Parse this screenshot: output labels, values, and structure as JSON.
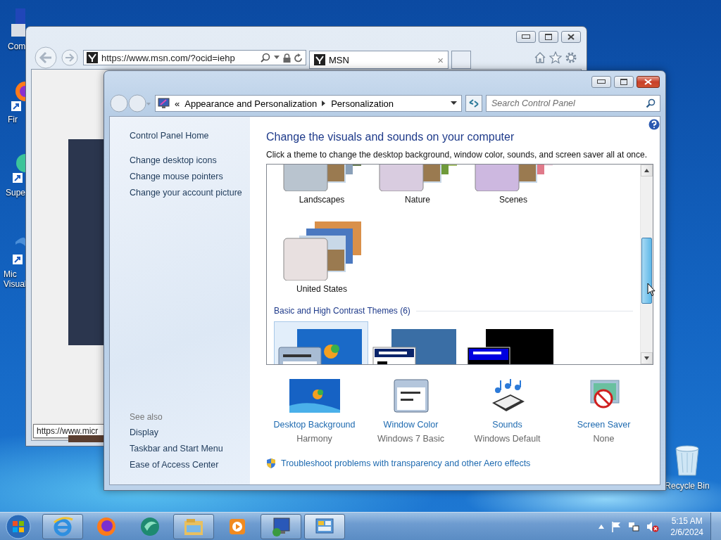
{
  "desktop": {
    "icons": [
      {
        "kind": "computer",
        "lines": [
          "Com"
        ]
      },
      {
        "kind": "firefox",
        "lines": [
          "Fir"
        ]
      },
      {
        "kind": "globe",
        "lines": [
          "Supe"
        ]
      },
      {
        "kind": "visual",
        "lines": [
          "Mic",
          "Visual"
        ]
      }
    ],
    "recycle_bin": {
      "label": "Recycle Bin"
    }
  },
  "browser": {
    "address": "https://www.msn.com/?ocid=iehp",
    "tab": {
      "title": "MSN",
      "close": "×"
    },
    "status_url": "https://www.micr"
  },
  "control_panel": {
    "breadcrumb_prefix": "«",
    "breadcrumb": [
      "Appearance and Personalization",
      "Personalization"
    ],
    "search": {
      "placeholder": "Search Control Panel"
    },
    "sidebar": {
      "links": [
        "Control Panel Home",
        "Change desktop icons",
        "Change mouse pointers",
        "Change your account picture"
      ],
      "see_also_title": "See also",
      "see_also": [
        "Display",
        "Taskbar and Start Menu",
        "Ease of Access Center"
      ]
    },
    "heading": "Change the visuals and sounds on your computer",
    "description": "Click a theme to change the desktop background, window color, sounds, and screen saver all at once.",
    "themes": [
      {
        "name": "Landscapes",
        "selected": false
      },
      {
        "name": "Nature",
        "selected": false
      },
      {
        "name": "Scenes",
        "selected": false
      },
      {
        "name": "United States",
        "selected": false
      }
    ],
    "group_title": "Basic and High Contrast Themes (6)",
    "basic_themes": [
      {
        "kind": "basic",
        "selected": true
      },
      {
        "kind": "classic",
        "selected": false
      },
      {
        "kind": "contrast",
        "selected": false
      }
    ],
    "settings": [
      {
        "kind": "background",
        "label": "Desktop Background",
        "value": "Harmony"
      },
      {
        "kind": "window",
        "label": "Window Color",
        "value": "Windows 7 Basic"
      },
      {
        "kind": "sounds",
        "label": "Sounds",
        "value": "Windows Default"
      },
      {
        "kind": "saver",
        "label": "Screen Saver",
        "value": "None"
      }
    ],
    "troubleshoot_link": "Troubleshoot problems with transparency and other Aero effects"
  },
  "taskbar": {
    "buttons": [
      {
        "kind": "ie",
        "open": true,
        "selected": false
      },
      {
        "kind": "firefox",
        "open": false,
        "selected": false
      },
      {
        "kind": "globe",
        "open": false,
        "selected": false
      },
      {
        "kind": "explorer",
        "open": true,
        "selected": false
      },
      {
        "kind": "media",
        "open": false,
        "selected": false
      },
      {
        "kind": "remote",
        "open": true,
        "selected": false
      },
      {
        "kind": "control",
        "open": true,
        "selected": true
      }
    ],
    "clock": {
      "time": "5:15 AM",
      "date": "2/6/2024"
    }
  }
}
